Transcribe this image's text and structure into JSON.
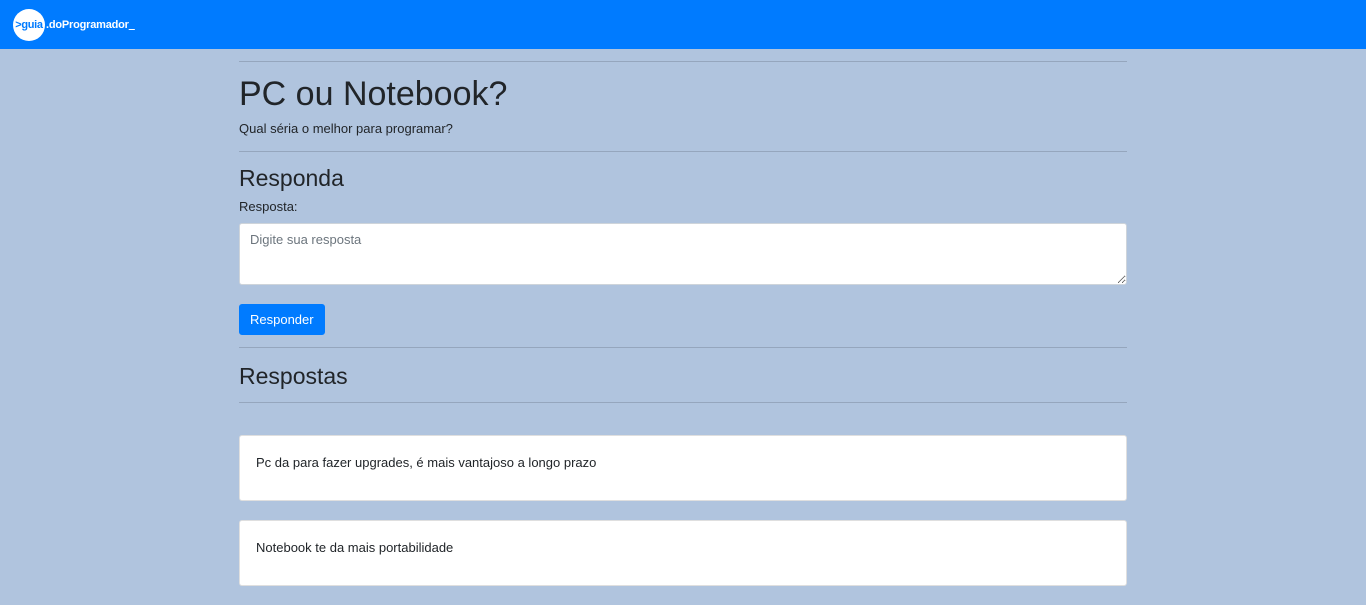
{
  "navbar": {
    "logo_mark": ">guia",
    "logo_text": ".doProgramador",
    "logo_suffix": "_"
  },
  "question": {
    "title": "PC ou Notebook?",
    "description": "Qual séria o melhor para programar?"
  },
  "answer_form": {
    "heading": "Responda",
    "label": "Resposta:",
    "placeholder": "Digite sua resposta",
    "value": "",
    "submit_label": "Responder"
  },
  "answers": {
    "heading": "Respostas",
    "items": [
      {
        "text": "Pc da para fazer upgrades, é mais vantajoso a longo prazo"
      },
      {
        "text": "Notebook te da mais portabilidade"
      }
    ]
  },
  "colors": {
    "navbar": "#007bff",
    "background": "#b0c4de",
    "button": "#007bff"
  }
}
